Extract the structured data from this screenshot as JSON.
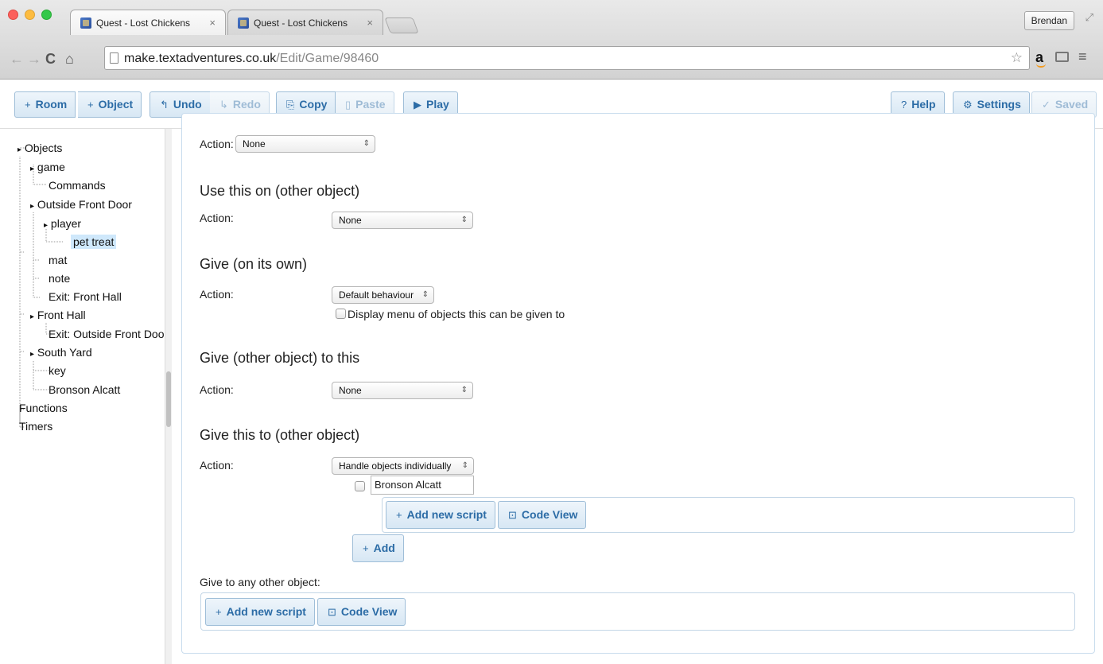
{
  "browser": {
    "tabs": [
      {
        "title": "Quest - Lost Chickens",
        "close": "×"
      },
      {
        "title": "Quest - Lost Chickens",
        "close": "×"
      }
    ],
    "profile_name": "Brendan",
    "url_host": "make.textadventures.co.uk",
    "url_path": "/Edit/Game/98460",
    "icons": [
      "back-arrow-icon",
      "forward-arrow-icon",
      "reload-icon",
      "home-icon",
      "page-icon",
      "star-icon",
      "amazon-icon",
      "cast-icon",
      "menu-icon",
      "fullscreen-icon"
    ]
  },
  "toolbar": {
    "room": "Room",
    "object": "Object",
    "undo": "Undo",
    "redo": "Redo",
    "copy": "Copy",
    "paste": "Paste",
    "play": "Play",
    "help": "Help",
    "settings": "Settings",
    "saved": "Saved",
    "icons": {
      "plus": "+",
      "undo": "↰",
      "redo": "↳",
      "copy": "⎘",
      "paste": "▯",
      "play": "▶",
      "help": "?",
      "settings": "⚙",
      "saved": "✓"
    }
  },
  "tree": {
    "items": [
      {
        "label": "Objects",
        "expander": "▸"
      },
      {
        "label": "game",
        "expander": "▸"
      },
      {
        "label": "Commands"
      },
      {
        "label": "Outside Front Door",
        "expander": "▸"
      },
      {
        "label": "player",
        "expander": "▸"
      },
      {
        "label": "pet treat",
        "selected": true
      },
      {
        "label": "mat"
      },
      {
        "label": "note"
      },
      {
        "label": "Exit: Front Hall"
      },
      {
        "label": "Front Hall",
        "expander": "▸"
      },
      {
        "label": "Exit: Outside Front Door"
      },
      {
        "label": "South Yard",
        "expander": "▸"
      },
      {
        "label": "key"
      },
      {
        "label": "Bronson Alcatt"
      },
      {
        "label": "Functions"
      },
      {
        "label": "Timers"
      }
    ]
  },
  "editor": {
    "top_action_label": "Action:",
    "top_action_value": "None",
    "sections": [
      {
        "title": "Use this on (other object)",
        "action_label": "Action:",
        "action_value": "None"
      },
      {
        "title": "Give (on its own)",
        "action_label": "Action:",
        "action_value": "Default behaviour",
        "checkbox_label": "Display menu of objects this can be given to"
      },
      {
        "title": "Give (other object) to this",
        "action_label": "Action:",
        "action_value": "None"
      },
      {
        "title": "Give this to (other object)",
        "action_label": "Action:",
        "action_value": "Handle objects individually",
        "object_value": "Bronson Alcatt"
      }
    ],
    "add_new_script": "Add new script",
    "code_view": "Code View",
    "add": "Add",
    "give_any_label": "Give to any other object:",
    "select_arrows": "⇕"
  }
}
